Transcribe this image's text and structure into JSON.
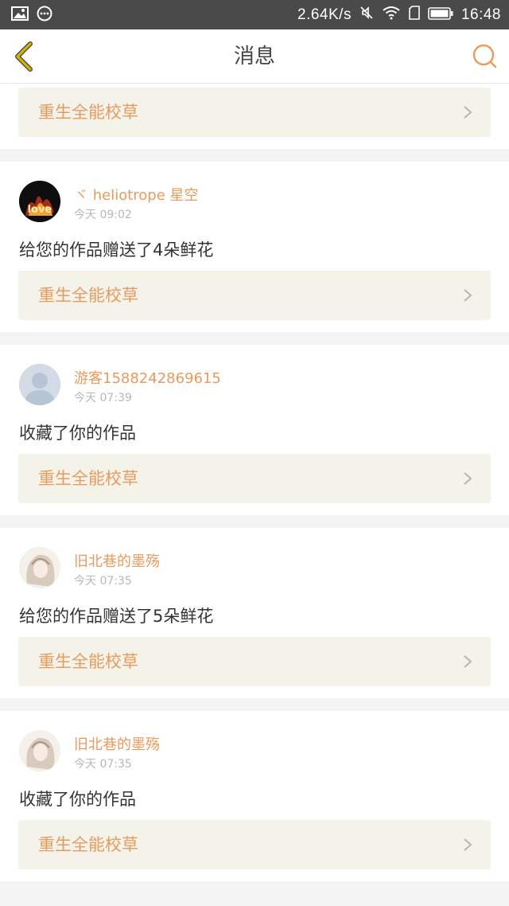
{
  "status_bar": {
    "network_speed": "2.64K/s",
    "time": "16:48",
    "icons": [
      "image-icon",
      "chat-bubble-icon",
      "mute-icon",
      "wifi-icon",
      "sim-icon",
      "battery-icon"
    ]
  },
  "header": {
    "title": "消息",
    "back_icon": "chevron-left-icon",
    "search_icon": "search-icon"
  },
  "colors": {
    "accent": "#e89b5e",
    "back_icon": "#c9a400",
    "work_bg": "#f3f3ea",
    "page_bg": "#f3f3f3"
  },
  "top_partial": {
    "work_title": "重生全能校草"
  },
  "messages": [
    {
      "username": "ヾ heliotrope 星空",
      "time": "今天 09:02",
      "action": "给您的作品赠送了4朵鲜花",
      "work_title": "重生全能校草",
      "avatar": "love-fire-avatar"
    },
    {
      "username": "游客1588242869615",
      "time": "今天 07:39",
      "action": "收藏了你的作品",
      "work_title": "重生全能校草",
      "avatar": "default-user-avatar"
    },
    {
      "username": "旧北巷的墨殇",
      "time": "今天 07:35",
      "action": "给您的作品赠送了5朵鲜花",
      "work_title": "重生全能校草",
      "avatar": "anime-girl-avatar"
    },
    {
      "username": "旧北巷的墨殇",
      "time": "今天 07:35",
      "action": "收藏了你的作品",
      "work_title": "重生全能校草",
      "avatar": "anime-girl-avatar"
    }
  ]
}
